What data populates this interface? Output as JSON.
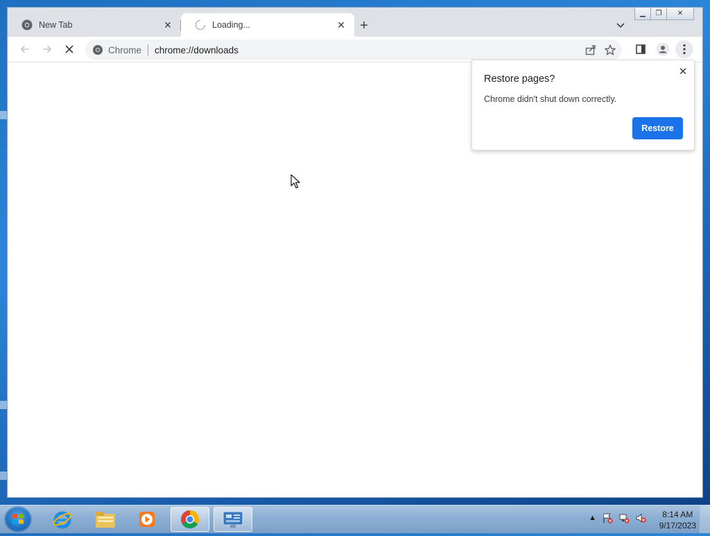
{
  "window": {
    "controls": {
      "minimize": "▁",
      "restore": "❐",
      "close": "✕"
    }
  },
  "tabs": [
    {
      "title": "New Tab",
      "state": "inactive",
      "favicon": "chrome-icon"
    },
    {
      "title": "Loading...",
      "state": "active",
      "favicon": "loading-spinner-icon"
    }
  ],
  "toolbar": {
    "back_icon": "arrow-left-icon",
    "forward_icon": "arrow-right-icon",
    "stop_icon": "close-icon",
    "omnibox": {
      "chip": "Chrome",
      "url": "chrome://downloads"
    }
  },
  "restore_bubble": {
    "title": "Restore pages?",
    "message": "Chrome didn't shut down correctly.",
    "button": "Restore",
    "button_color": "#1a73e8"
  },
  "taskbar": {
    "items": [
      {
        "name": "start-button"
      },
      {
        "name": "internet-explorer"
      },
      {
        "name": "file-explorer"
      },
      {
        "name": "media-player"
      },
      {
        "name": "chrome",
        "active": true
      },
      {
        "name": "control-panel",
        "active": true
      }
    ],
    "clock": {
      "time": "8:14 AM",
      "date": "9/17/2023"
    }
  }
}
